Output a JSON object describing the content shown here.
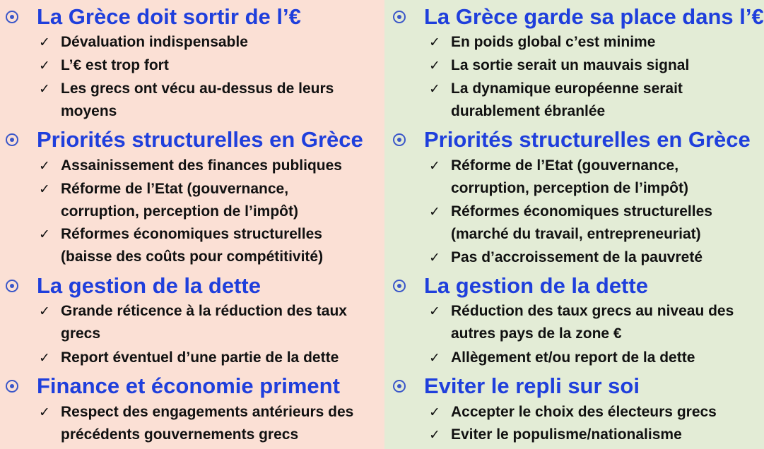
{
  "left": {
    "sections": [
      {
        "title": "La Grèce doit sortir de l’€",
        "items": [
          "Dévaluation indispensable",
          "L’€ est trop fort",
          "Les grecs ont vécu au-dessus de leurs moyens"
        ]
      },
      {
        "title": "Priorités structurelles en Grèce",
        "items": [
          "Assainissement des finances publiques",
          "Réforme de l’Etat (gouvernance, corruption, perception de l’impôt)",
          "Réformes économiques structurelles (baisse des coûts pour compétitivité)"
        ]
      },
      {
        "title": "La gestion de la dette",
        "items": [
          "Grande réticence à la réduction des taux grecs",
          "Report éventuel d’une partie de la dette"
        ]
      },
      {
        "title": "Finance et économie priment",
        "items": [
          "Respect des engagements antérieurs des précédents gouvernements grecs"
        ]
      }
    ]
  },
  "right": {
    "sections": [
      {
        "title": "La Grèce garde sa place dans l’€",
        "items": [
          "En poids global c’est minime",
          "La sortie serait un mauvais signal",
          "La dynamique européenne serait durablement ébranlée"
        ]
      },
      {
        "title": "Priorités structurelles en Grèce",
        "items": [
          "Réforme de l’Etat (gouvernance, corruption, perception de l’impôt)",
          "Réformes économiques structurelles (marché du travail, entrepreneuriat)",
          "Pas d’accroissement de la pauvreté"
        ]
      },
      {
        "title": "La gestion de la dette",
        "items": [
          "Réduction des taux grecs au niveau des autres pays de la zone €",
          "Allègement et/ou report de la dette"
        ]
      },
      {
        "title": "Eviter le repli sur soi",
        "items": [
          "Accepter le choix des électeurs grecs",
          "Eviter le populisme/nationalisme"
        ]
      }
    ]
  },
  "colors": {
    "left_bg": "#fbe0d5",
    "right_bg": "#e3ecd6",
    "heading": "#1f3fdc",
    "bullet": "#3b57c9",
    "text": "#111111"
  },
  "icons": {
    "section_bullet": "radio-bullet-icon",
    "item_bullet": "check-icon"
  }
}
